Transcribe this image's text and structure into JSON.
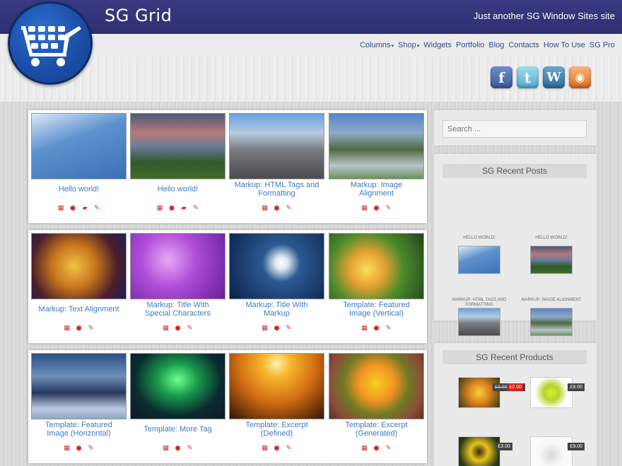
{
  "header": {
    "site_title": "SG Grid",
    "tagline": "Just another SG Window Sites site"
  },
  "nav": {
    "items": [
      {
        "label": "Columns",
        "has_dropdown": true
      },
      {
        "label": "Shop",
        "has_dropdown": true
      },
      {
        "label": "Widgets",
        "has_dropdown": false
      },
      {
        "label": "Portfolio",
        "has_dropdown": false
      },
      {
        "label": "Blog",
        "has_dropdown": false
      },
      {
        "label": "Contacts",
        "has_dropdown": false
      },
      {
        "label": "How To Use",
        "has_dropdown": false
      },
      {
        "label": "SG Pro",
        "has_dropdown": false
      }
    ]
  },
  "social": {
    "facebook": "f",
    "twitter": "t",
    "wordpress": "W",
    "rss": "◉"
  },
  "posts": {
    "row1": [
      {
        "title": "Hello world!",
        "image": "g-sky",
        "comments": true
      },
      {
        "title": "Hello world!",
        "image": "g-sunset",
        "comments": true
      },
      {
        "title": "Markup: HTML Tags and Formatting",
        "image": "g-peak",
        "comments": false
      },
      {
        "title": "Markup: Image Alignment",
        "image": "g-valley",
        "comments": false
      }
    ],
    "row2": [
      {
        "title": "Markup: Text Alignment",
        "image": "g-dragon",
        "comments": false
      },
      {
        "title": "Markup: Title With Special Characters",
        "image": "g-flowers",
        "comments": false
      },
      {
        "title": "Markup: Title With Markup",
        "image": "g-swan",
        "comments": false
      },
      {
        "title": "Template: Featured Image (Vertical)",
        "image": "g-poppies",
        "comments": false
      }
    ],
    "row3": [
      {
        "title": "Template: Featured Image (Horizontal)",
        "image": "g-clouds",
        "comments": false
      },
      {
        "title": "Template: More Tag",
        "image": "g-aurora",
        "comments": false
      },
      {
        "title": "Template: Excerpt (Defined)",
        "image": "g-sun",
        "comments": false
      },
      {
        "title": "Template: Excerpt (Generated)",
        "image": "g-parrots",
        "comments": false
      }
    ]
  },
  "sidebar": {
    "search_placeholder": "Search ...",
    "recent_posts_title": "SG Recent Posts",
    "recent_posts": [
      {
        "title": "HELLO WORLD!",
        "image": "g-sky"
      },
      {
        "title": "HELLO WORLD!",
        "image": "g-sunset"
      },
      {
        "title": "MARKUP: HTML TAGS AND FORMATTING",
        "image": "g-peak"
      },
      {
        "title": "MARKUP: IMAGE ALIGNMENT",
        "image": "g-valley"
      }
    ],
    "recent_products_title": "SG Recent Products",
    "products": [
      {
        "image": "g-flower2",
        "old_price": "£3.00",
        "price": "£2.00",
        "on_sale": true
      },
      {
        "image": "g-shoe",
        "price": "£9.00",
        "on_sale": false
      },
      {
        "image": "g-sunflower",
        "price": "£3.00",
        "on_sale": false
      },
      {
        "image": "g-shoe2",
        "price": "£9.00",
        "on_sale": false
      }
    ]
  },
  "icons": {
    "date": "calendar-icon",
    "author": "user-icon",
    "comments": "comment-icon",
    "edit": "pencil-icon"
  },
  "colors": {
    "header": "#33337a",
    "link": "#3f7ac2",
    "meta_icon": "#d42a2a"
  }
}
